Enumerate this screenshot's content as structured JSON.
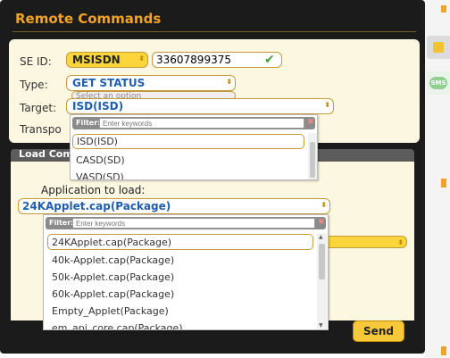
{
  "title": "Remote Commands",
  "se_id": {
    "label": "SE ID:",
    "type_value": "MSISDN",
    "value": "33607899375"
  },
  "type": {
    "label": "Type:",
    "value": "GET STATUS"
  },
  "select_placeholder": "Select an option",
  "target": {
    "label": "Target:",
    "value": "ISD(ISD)"
  },
  "transport_label": "Transpo",
  "target_dropdown": {
    "filter_label": "Filter:",
    "filter_placeholder": "Enter keywords",
    "options": [
      "ISD(ISD)",
      "CASD(SD)",
      "VASD(SD)"
    ]
  },
  "load_component": {
    "header": "Load Com",
    "app_label": "Application to load:",
    "app_value": "24KApplet.cap(Package)",
    "dropdown": {
      "filter_label": "Filter:",
      "filter_placeholder": "Enter keywords",
      "options": [
        "24KApplet.cap(Package)",
        "40k-Applet.cap(Package)",
        "50k-Applet.cap(Package)",
        "60k-Applet.cap(Package)",
        "Empty_Applet(Package)",
        "em_api_core.cap(Package)"
      ]
    }
  },
  "send_label": "Send",
  "side_icons": [
    "sim-card-icon",
    "sms-icon"
  ],
  "colors": {
    "accent": "#f0a326",
    "panel": "#fcf7e1",
    "window": "#1b1b1b",
    "button": "#f7c93a"
  }
}
